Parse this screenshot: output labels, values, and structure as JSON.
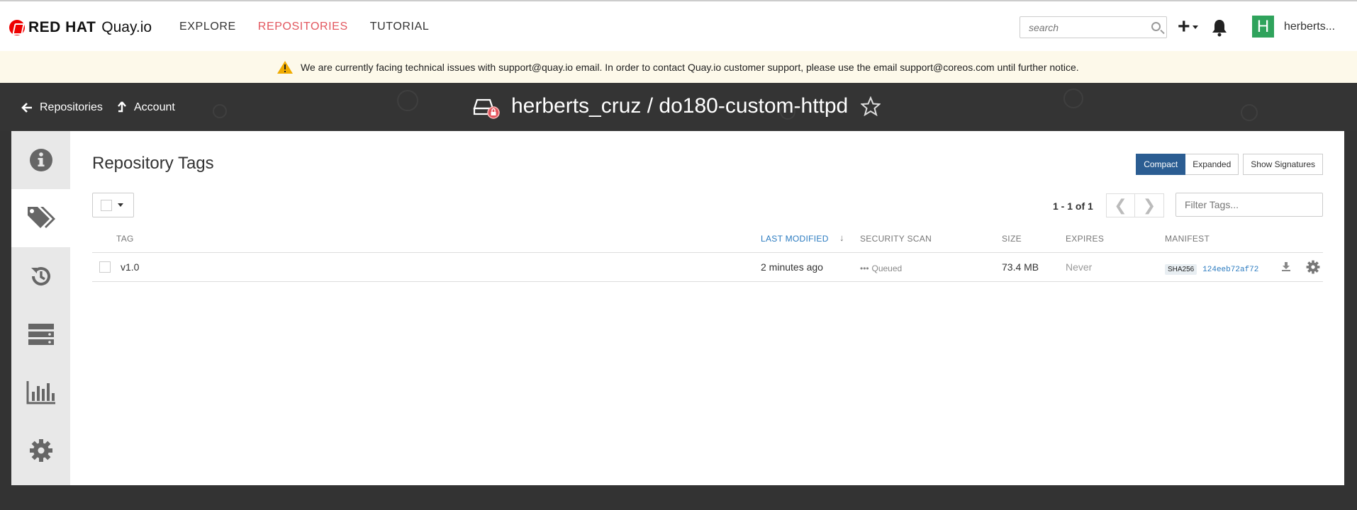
{
  "nav": {
    "brand_redhat": "RED HAT",
    "brand_product": "Quay.io",
    "links": [
      {
        "label": "EXPLORE",
        "active": false
      },
      {
        "label": "REPOSITORIES",
        "active": true
      },
      {
        "label": "TUTORIAL",
        "active": false
      }
    ],
    "search_placeholder": "search",
    "user_initial": "H",
    "user_name": "herberts..."
  },
  "banner": {
    "message": "We are currently facing technical issues with support@quay.io email. In order to contact Quay.io customer support, please use the email support@coreos.com until further notice."
  },
  "header": {
    "back_label": "Repositories",
    "account_label": "Account",
    "repo_title": "herberts_cruz / do180-custom-httpd"
  },
  "sidebar": {
    "items": [
      {
        "icon": "info-icon",
        "active": false
      },
      {
        "icon": "tags-icon",
        "active": true
      },
      {
        "icon": "history-icon",
        "active": false
      },
      {
        "icon": "builds-icon",
        "active": false
      },
      {
        "icon": "usage-logs-icon",
        "active": false
      },
      {
        "icon": "gear-icon",
        "active": false
      }
    ]
  },
  "tags": {
    "title": "Repository Tags",
    "view_compact": "Compact",
    "view_expanded": "Expanded",
    "show_signatures": "Show Signatures",
    "pager_text": "1 - 1 of 1",
    "filter_placeholder": "Filter Tags...",
    "columns": {
      "tag": "TAG",
      "last_modified": "LAST MODIFIED",
      "security_scan": "SECURITY SCAN",
      "size": "SIZE",
      "expires": "EXPIRES",
      "manifest": "MANIFEST"
    },
    "rows": [
      {
        "tag": "v1.0",
        "last_modified": "2 minutes ago",
        "security_scan": "Queued",
        "size": "73.4 MB",
        "expires": "Never",
        "manifest_algo": "SHA256",
        "manifest_digest": "124eeb72af72"
      }
    ]
  },
  "colors": {
    "accent_red": "#e2565e",
    "primary_blue": "#2b5d92",
    "link_blue": "#2b7bc0",
    "header_dark": "#343434",
    "avatar_green": "#2fa35c"
  }
}
